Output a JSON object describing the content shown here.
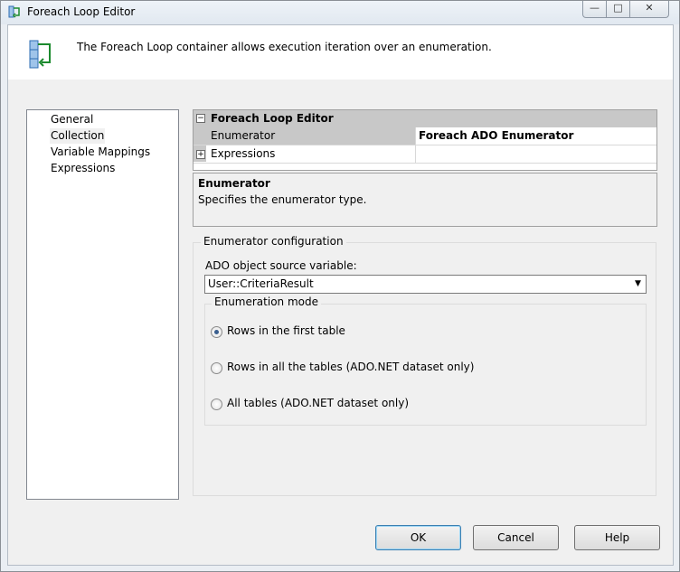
{
  "window": {
    "title": "Foreach Loop Editor",
    "minimize_glyph": "—",
    "maximize_glyph": "□",
    "close_glyph": "✕"
  },
  "header": {
    "description": "The Foreach Loop container allows execution iteration over an enumeration.",
    "icon": "foreach-loop-icon"
  },
  "nav": {
    "items": [
      {
        "label": "General"
      },
      {
        "label": "Collection"
      },
      {
        "label": "Variable Mappings"
      },
      {
        "label": "Expressions"
      }
    ],
    "selected": "Collection"
  },
  "property_grid": {
    "category": "Foreach Loop Editor",
    "collapse_glyph": "−",
    "expand_glyph": "+",
    "rows": [
      {
        "name": "Enumerator",
        "value": "Foreach ADO Enumerator"
      },
      {
        "name": "Expressions",
        "value": ""
      }
    ]
  },
  "description_panel": {
    "title": "Enumerator",
    "text": "Specifies the enumerator type."
  },
  "config": {
    "group_label": "Enumerator configuration",
    "source_label": "ADO object source variable:",
    "source_value": "User::CriteriaResult",
    "dropdown_glyph": "▼",
    "mode_label": "Enumeration mode",
    "modes": [
      {
        "label": "Rows in the first table",
        "selected": true
      },
      {
        "label": "Rows in all the tables (ADO.NET dataset only)",
        "selected": false
      },
      {
        "label": "All tables (ADO.NET dataset only)",
        "selected": false
      }
    ]
  },
  "buttons": {
    "ok": "OK",
    "cancel": "Cancel",
    "help": "Help"
  },
  "colors": {
    "accent_border": "#3c7fb1",
    "grid_category": "#c8c8c8"
  }
}
